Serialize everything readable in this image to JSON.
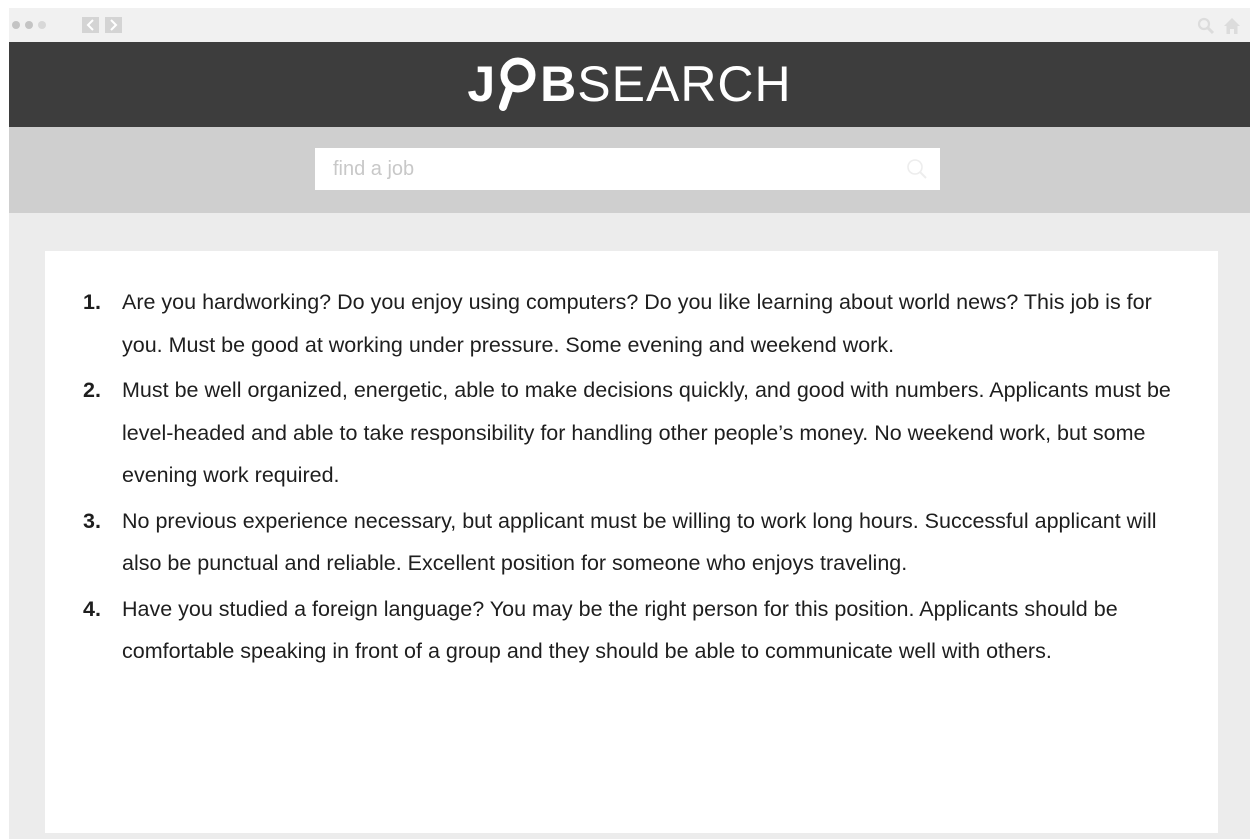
{
  "browser": {
    "back_icon": "chevron-left-icon",
    "forward_icon": "chevron-right-icon",
    "search_icon": "search-icon",
    "home_icon": "home-icon"
  },
  "header": {
    "logo_bold_left": "J",
    "logo_bold_right": "B",
    "logo_thin": "SEARCH",
    "logo_o_icon": "magnifier-icon",
    "background_color": "#3d3d3d"
  },
  "search": {
    "placeholder": "find a job",
    "value": "",
    "icon": "search-icon"
  },
  "jobs": [
    {
      "number": "1.",
      "text": "Are you hardworking? Do you enjoy using computers? Do you like learning about world news? This job is for you. Must be good at working under pressure. Some evening and weekend work."
    },
    {
      "number": "2.",
      "text": "Must be well organized, energetic, able to make decisions quickly, and good with numbers. Applicants must be level-headed and able to take responsibility for handling other people’s money. No weekend work, but some evening work required."
    },
    {
      "number": "3.",
      "text": "No previous experience necessary, but applicant must be willing to work long hours. Successful applicant will also be punctual and reliable. Excellent position for someone who enjoys traveling."
    },
    {
      "number": "4.",
      "text": "Have you studied a foreign language? You may be the right person for this position. Applicants should be comfortable speaking in front of a group and they should be able to communicate well with others."
    }
  ]
}
